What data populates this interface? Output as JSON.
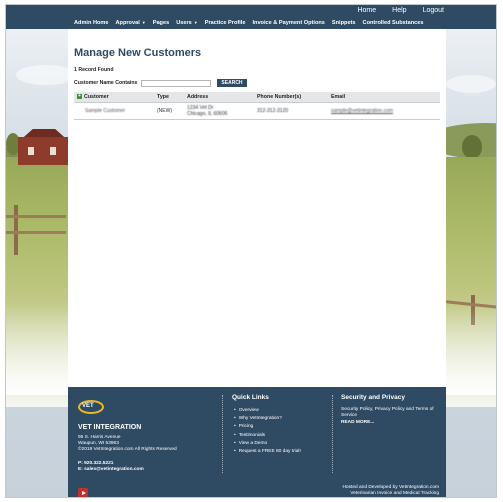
{
  "utility_nav": [
    "Home",
    "Help",
    "Logout"
  ],
  "main_nav": [
    {
      "label": "Admin Home",
      "dropdown": false
    },
    {
      "label": "Approval",
      "dropdown": true
    },
    {
      "label": "Pages",
      "dropdown": false
    },
    {
      "label": "Users",
      "dropdown": true
    },
    {
      "label": "Practice Profile",
      "dropdown": false
    },
    {
      "label": "Invoice & Payment Options",
      "dropdown": false
    },
    {
      "label": "Snippets",
      "dropdown": false
    },
    {
      "label": "Controlled Substances",
      "dropdown": false
    }
  ],
  "page": {
    "title": "Manage New Customers",
    "record_count": "1 Record Found",
    "search_label": "Customer Name Contains",
    "search_value": "",
    "search_button": "SEARCH"
  },
  "table": {
    "headers": [
      "Customer",
      "Type",
      "Address",
      "Phone Number(s)",
      "Email"
    ],
    "rows": [
      {
        "customer": "Sample Customer",
        "type": "(NEW)",
        "address_line1": "1234 Vet Dr",
        "address_line2": "Chicago, IL 60606",
        "phone": "312-312-3120",
        "email": "sample@vetintegration.com"
      }
    ]
  },
  "footer": {
    "logo_text": "VET",
    "brand": "VET INTEGRATION",
    "address": [
      "95 S. Harris Avenue",
      "Waupun, WI 53963",
      "©2019 VetIntegration.com All Rights Reserved"
    ],
    "phone": "P: 920.322.5221",
    "email": "E: sales@vetintegration.com",
    "quick_links_title": "Quick Links",
    "quick_links": [
      "Overview",
      "Why VetIntegration?",
      "Pricing",
      "Testimonials",
      "View a Demo",
      "Request a FREE 60 day trial!"
    ],
    "security_title": "Security and Privacy",
    "security_text": "Security Policy, Privacy Policy and Terms of Service",
    "security_more": "READ MORE...",
    "credit_line1": "Hosted and Developed by VetIntegration.com",
    "credit_line2": "Veterinarian Invoice and Medical Tracking",
    "youtube": "youtube-icon"
  },
  "colors": {
    "nav": "#2f4a63",
    "accent_logo": "#e8b926"
  }
}
